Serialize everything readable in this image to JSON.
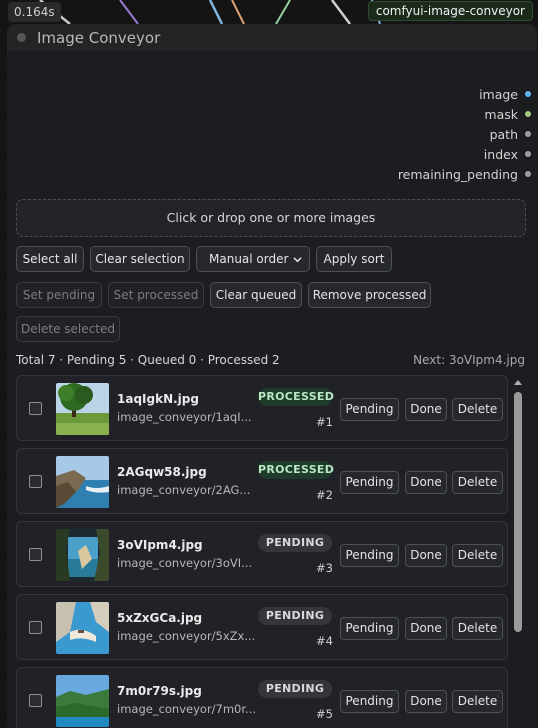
{
  "timing": "0.164s",
  "badge": "comfyui-image-conveyor",
  "node": {
    "title": "Image Conveyor"
  },
  "outputs": [
    {
      "label": "image",
      "color": "#64b5f6"
    },
    {
      "label": "mask",
      "color": "#81c784"
    },
    {
      "label": "path",
      "color": "#9e9e9e"
    },
    {
      "label": "index",
      "color": "#9e9e9e"
    },
    {
      "label": "remaining_pending",
      "color": "#9e9e9e"
    }
  ],
  "dropzone": "Click or drop one or more images",
  "toolbar": {
    "select_all": "Select all",
    "clear_selection": "Clear selection",
    "order_select": "Manual order",
    "apply_sort": "Apply sort",
    "set_pending": "Set pending",
    "set_processed": "Set processed",
    "clear_queued": "Clear queued",
    "remove_processed": "Remove processed",
    "delete_selected": "Delete selected"
  },
  "summary": "Total 7 · Pending 5 · Queued 0 · Processed 2",
  "next": "Next: 3oVIpm4.jpg",
  "item_buttons": {
    "pending": "Pending",
    "done": "Done",
    "delete": "Delete"
  },
  "items": [
    {
      "name": "1aqIgkN.jpg",
      "path": "image_conveyor/1aqI...",
      "status": "PROCESSED",
      "order": "#1",
      "thumb": "tree-meadow"
    },
    {
      "name": "2AGqw58.jpg",
      "path": "image_conveyor/2AG...",
      "status": "PROCESSED",
      "order": "#2",
      "thumb": "coast-cliffs"
    },
    {
      "name": "3oVIpm4.jpg",
      "path": "image_conveyor/3oVI...",
      "status": "PENDING",
      "order": "#3",
      "thumb": "cave-sea"
    },
    {
      "name": "5xZxGCa.jpg",
      "path": "image_conveyor/5xZx...",
      "status": "PENDING",
      "order": "#4",
      "thumb": "shipwreck-beach"
    },
    {
      "name": "7m0r79s.jpg",
      "path": "image_conveyor/7m0r...",
      "status": "PENDING",
      "order": "#5",
      "thumb": "green-hills"
    }
  ]
}
